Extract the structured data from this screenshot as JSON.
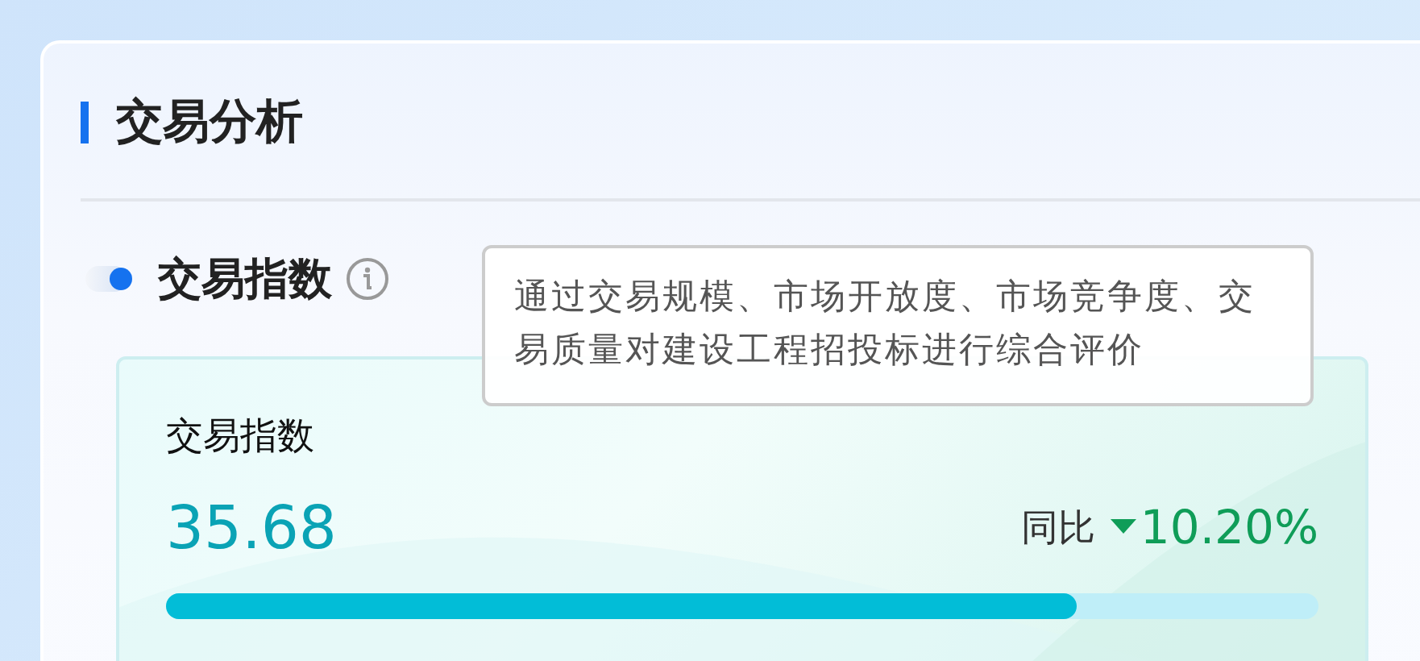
{
  "panel": {
    "title": "交易分析"
  },
  "section": {
    "title": "交易指数",
    "tooltip": "通过交易规模、市场开放度、市场竞争度、交易质量对建设工程招投标进行综合评价"
  },
  "metric": {
    "label": "交易指数",
    "value": "35.68",
    "compare_label": "同比",
    "decreased": true,
    "change": "10.20%",
    "level": 0.79
  }
}
